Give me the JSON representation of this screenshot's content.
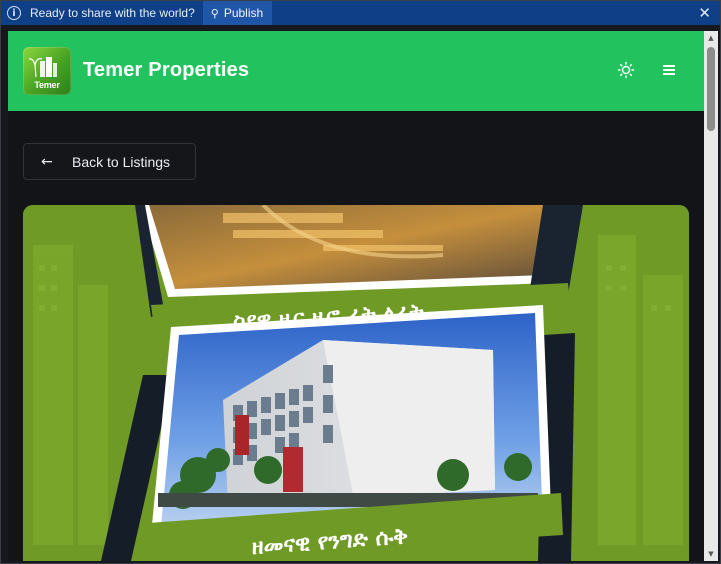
{
  "infobar": {
    "message": "Ready to share with the world?",
    "publish_label": "Publish",
    "info_icon": "info-icon",
    "pin_icon": "pin-icon",
    "close_icon": "close-icon"
  },
  "header": {
    "logo_text": "Temer",
    "brand": "Temer Properties",
    "theme_icon": "sun-icon",
    "menu_icon": "hamburger-menu-icon",
    "background": "#22c35e"
  },
  "back": {
    "label": "Back to Listings",
    "icon": "arrow-left-icon"
  },
  "hero": {
    "caption_top": "ስደዋ ዜር ዜሮ ፊት ለፊት",
    "caption_bottom": "ዘመናዊ የንግድ ሱቅ",
    "background": "#6f9a26"
  }
}
